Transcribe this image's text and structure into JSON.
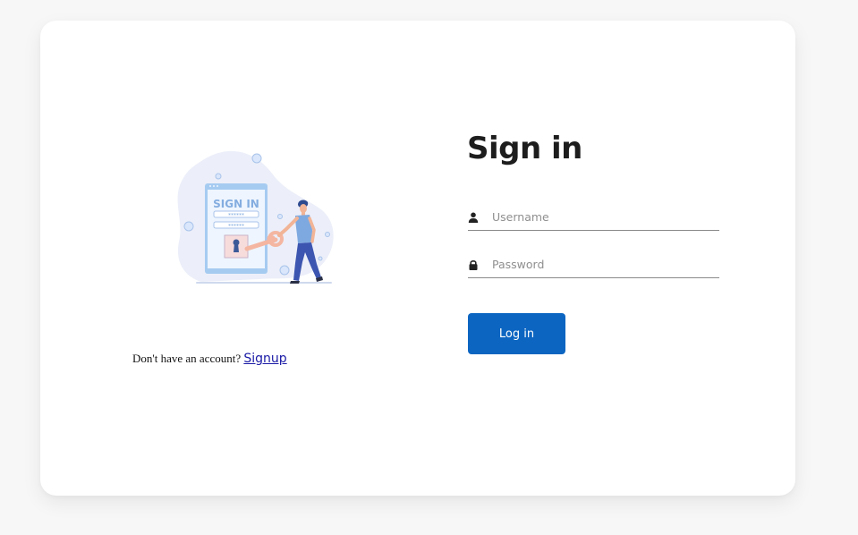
{
  "illustration": {
    "screen_heading": "SIGN IN",
    "masked_text": "******"
  },
  "signup": {
    "prompt": "Don't have an account?",
    "link_label": "Signup"
  },
  "form": {
    "title": "Sign in",
    "username": {
      "placeholder": "Username",
      "value": "",
      "icon": "user-icon"
    },
    "password": {
      "placeholder": "Password",
      "value": "",
      "icon": "lock-icon"
    },
    "submit_label": "Log in"
  },
  "colors": {
    "page_background": "#f7f7f7",
    "card_background": "#ffffff",
    "primary": "#0c65c1",
    "title_text": "#1d1d1d",
    "link": "#1a1aa6"
  }
}
